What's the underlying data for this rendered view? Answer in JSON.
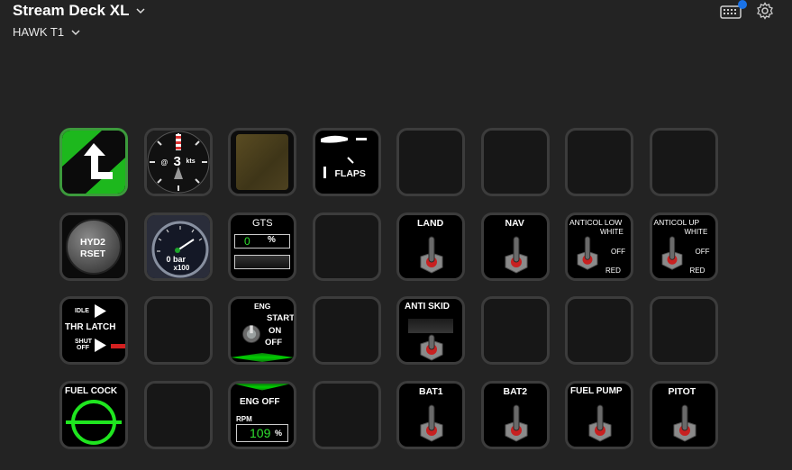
{
  "header": {
    "device": "Stream Deck XL",
    "profile": "HAWK T1"
  },
  "keys": {
    "k00": {
      "icon": "arrow-up-left-icon"
    },
    "k01": {
      "speed": "3",
      "at": "@",
      "unit": "kts"
    },
    "k03": {
      "label": "FLAPS"
    },
    "k10": {
      "line1": "HYD2",
      "line2": "RSET"
    },
    "k11": {
      "reading": "0 bar",
      "scale": "x100"
    },
    "k12": {
      "title": "GTS",
      "value": "0",
      "unit": "%"
    },
    "k14": {
      "label": "LAND"
    },
    "k15": {
      "label": "NAV"
    },
    "k16": {
      "label": "ANTICOL LOW",
      "pos1": "WHITE",
      "pos2": "OFF",
      "pos3": "RED"
    },
    "k17": {
      "label": "ANTICOL UP",
      "pos1": "WHITE",
      "pos2": "OFF",
      "pos3": "RED"
    },
    "k20": {
      "idle": "IDLE",
      "label": "THR LATCH",
      "shut": "SHUT",
      "off": "OFF"
    },
    "k22": {
      "label": "ENG",
      "start": "START",
      "on": "ON",
      "off": "OFF"
    },
    "k24": {
      "label": "ANTI SKID"
    },
    "k30": {
      "label": "FUEL COCK"
    },
    "k32": {
      "label": "ENG OFF",
      "rpm": "RPM",
      "value": "109",
      "unit": "%"
    },
    "k34": {
      "label": "BAT1"
    },
    "k35": {
      "label": "BAT2"
    },
    "k36": {
      "label": "FUEL PUMP"
    },
    "k37": {
      "label": "PITOT"
    }
  },
  "colors": {
    "accent_green": "#00e600",
    "toggle_red": "#d32020",
    "badge_blue": "#1a73e8"
  }
}
